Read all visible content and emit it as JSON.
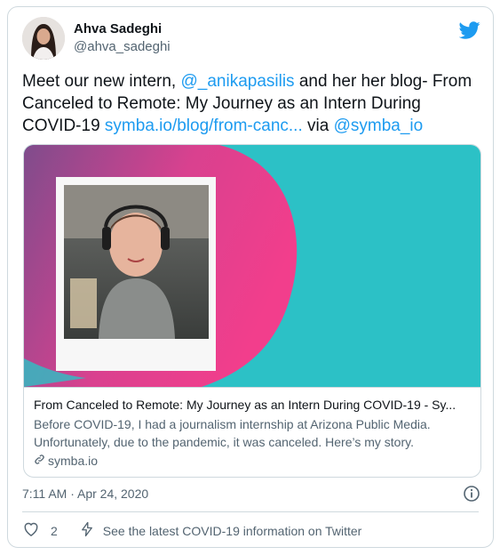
{
  "author": {
    "name": "Ahva Sadeghi",
    "handle": "@ahva_sadeghi"
  },
  "tweet": {
    "text_part1": "Meet our new intern, ",
    "mention1": "@_anikapasilis",
    "text_part2": " and her her blog- From Canceled to Remote: My Journey as an Intern During COVID-19 ",
    "url": "symba.io/blog/from-canc...",
    "text_part3": " via ",
    "mention2": "@symba_io"
  },
  "card": {
    "title": "From Canceled to Remote: My Journey as an Intern During COVID-19 - Sy...",
    "description": "Before COVID-19, I had a journalism internship at Arizona Public Media. Unfortunately, due to the pandemic, it was canceled. Here’s my story.",
    "domain": "symba.io"
  },
  "meta": {
    "timestamp": "7:11 AM · Apr 24, 2020"
  },
  "actions": {
    "like_count": "2",
    "covid_link": "See the latest COVID-19 information on Twitter"
  },
  "colors": {
    "link": "#1d9bf0",
    "card_teal": "#2cc1c6",
    "card_pink": "#ee3e8f",
    "card_purple": "#8b4a8e"
  },
  "icons": [
    "twitter-bird-icon",
    "info-icon",
    "heart-icon",
    "lightning-icon",
    "link-icon"
  ]
}
